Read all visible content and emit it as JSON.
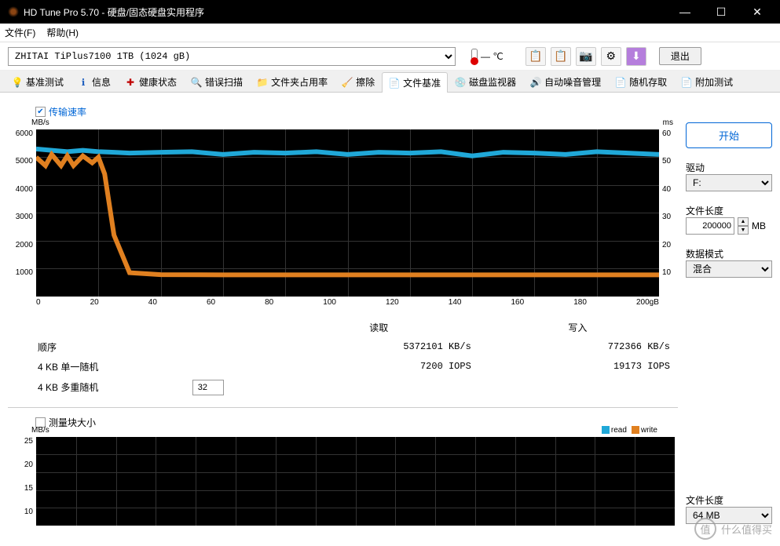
{
  "window": {
    "title": "HD Tune Pro 5.70 - 硬盘/固态硬盘实用程序",
    "min_icon": "—",
    "max_icon": "☐",
    "close_icon": "✕"
  },
  "menu": {
    "file": "文件(F)",
    "help": "帮助(H)"
  },
  "toolbar": {
    "drive": "ZHITAI TiPlus7100 1TB (1024 gB)",
    "temp": "— ℃",
    "exit": "退出",
    "icons": {
      "copy": "📋",
      "paste": "📋",
      "camera": "📷",
      "settings": "⚙",
      "down": "⬇"
    }
  },
  "tabs": [
    {
      "icon": "💡",
      "label": "基准测试",
      "color": "#e0c000"
    },
    {
      "icon": "ℹ",
      "label": "信息",
      "color": "#2060c0"
    },
    {
      "icon": "✚",
      "label": "健康状态",
      "color": "#c00000"
    },
    {
      "icon": "🔍",
      "label": "错误扫描",
      "color": "#2060c0"
    },
    {
      "icon": "📁",
      "label": "文件夹占用率",
      "color": "#c07000"
    },
    {
      "icon": "🧹",
      "label": "擦除",
      "color": "#606060"
    },
    {
      "icon": "📄",
      "label": "文件基准",
      "color": "#c07000",
      "active": true
    },
    {
      "icon": "💿",
      "label": "磁盘监视器",
      "color": "#606060"
    },
    {
      "icon": "🔊",
      "label": "自动噪音管理",
      "color": "#c07000"
    },
    {
      "icon": "📄",
      "label": "随机存取",
      "color": "#c07000"
    },
    {
      "icon": "📄",
      "label": "附加测试",
      "color": "#c07000"
    }
  ],
  "checkbox1": {
    "label": "传输速率",
    "checked": true
  },
  "chart_data": [
    {
      "type": "line",
      "title": "",
      "xlabel": "gB",
      "ylabel_left": "MB/s",
      "ylabel_right": "ms",
      "x_ticks": [
        0,
        20,
        40,
        60,
        80,
        100,
        120,
        140,
        160,
        180,
        "200gB"
      ],
      "y_ticks_left": [
        6000,
        5000,
        4000,
        3000,
        2000,
        1000,
        ""
      ],
      "y_ticks_right": [
        60,
        50,
        40,
        30,
        20,
        10,
        ""
      ],
      "ylim_left": [
        0,
        6000
      ],
      "xlim": [
        0,
        200
      ],
      "series": [
        {
          "name": "read",
          "color": "#20a8d8",
          "x": [
            0,
            5,
            10,
            15,
            20,
            25,
            30,
            40,
            50,
            60,
            70,
            80,
            90,
            100,
            110,
            120,
            130,
            140,
            150,
            160,
            170,
            180,
            190,
            200
          ],
          "values": [
            5300,
            5250,
            5200,
            5250,
            5200,
            5180,
            5150,
            5180,
            5200,
            5100,
            5180,
            5150,
            5200,
            5100,
            5180,
            5150,
            5200,
            5050,
            5180,
            5150,
            5100,
            5200,
            5150,
            5100
          ]
        },
        {
          "name": "write",
          "color": "#e08020",
          "x": [
            0,
            3,
            5,
            8,
            10,
            12,
            15,
            18,
            20,
            22,
            25,
            30,
            40,
            60,
            80,
            100,
            120,
            140,
            160,
            180,
            200
          ],
          "values": [
            5000,
            4700,
            5100,
            4700,
            5050,
            4700,
            5050,
            4800,
            5000,
            4400,
            2200,
            850,
            780,
            770,
            770,
            770,
            770,
            770,
            770,
            770,
            770
          ]
        }
      ]
    },
    {
      "type": "bar",
      "ylabel_left": "MB/s",
      "y_ticks_left": [
        25,
        20,
        15,
        10
      ],
      "ylim_left": [
        0,
        25
      ],
      "series": [
        {
          "name": "read",
          "color": "#20a8d8",
          "values": []
        },
        {
          "name": "write",
          "color": "#e08020",
          "values": []
        }
      ]
    }
  ],
  "results": {
    "headers": {
      "read": "读取",
      "write": "写入"
    },
    "rows": [
      {
        "label": "顺序",
        "read": "5372101 KB/s",
        "write": "772366 KB/s"
      },
      {
        "label": "4 KB 单一随机",
        "read": "7200 IOPS",
        "write": "19173 IOPS"
      },
      {
        "label": "4 KB 多重随机",
        "spinner": "32",
        "read": "",
        "write": ""
      }
    ]
  },
  "checkbox2": {
    "label": "测量块大小",
    "checked": false
  },
  "legend": {
    "read": "read",
    "write": "write"
  },
  "right": {
    "start": "开始",
    "drive_label": "驱动",
    "drive_value": "F:",
    "filelen_label": "文件长度",
    "filelen_value": "200000",
    "filelen_unit": "MB",
    "pattern_label": "数据模式",
    "pattern_value": "混合",
    "filelen2_label": "文件长度",
    "filelen2_value": "64 MB"
  },
  "watermark": {
    "icon": "值",
    "text": "什么值得买"
  }
}
